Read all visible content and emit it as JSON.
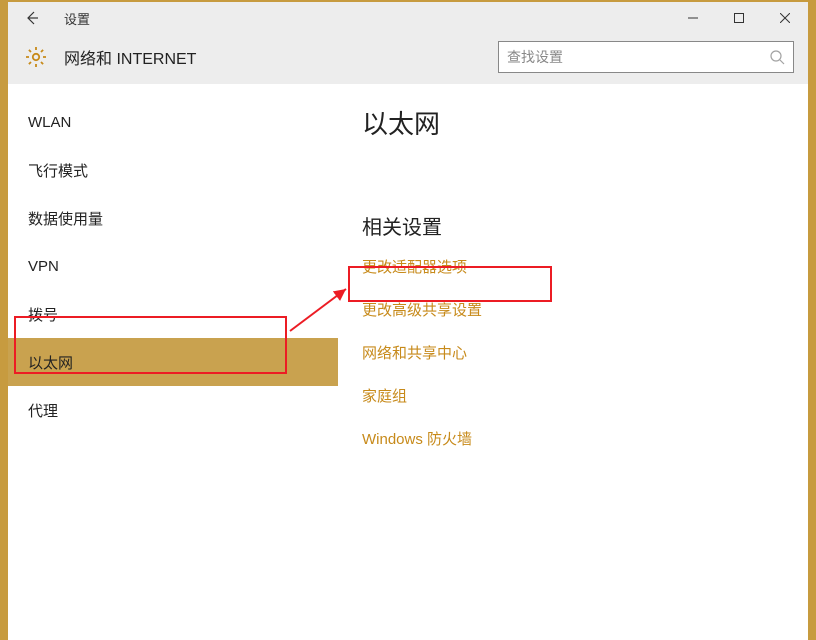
{
  "titlebar": {
    "title": "设置"
  },
  "header": {
    "label": "网络和 INTERNET"
  },
  "search": {
    "placeholder": "查找设置"
  },
  "sidebar": {
    "items": [
      {
        "label": "WLAN",
        "selected": false
      },
      {
        "label": "飞行模式",
        "selected": false
      },
      {
        "label": "数据使用量",
        "selected": false
      },
      {
        "label": "VPN",
        "selected": false
      },
      {
        "label": "拨号",
        "selected": false
      },
      {
        "label": "以太网",
        "selected": true
      },
      {
        "label": "代理",
        "selected": false
      }
    ]
  },
  "content": {
    "heading": "以太网",
    "related_heading": "相关设置",
    "links": [
      "更改适配器选项",
      "更改高级共享设置",
      "网络和共享中心",
      "家庭组",
      "Windows 防火墙"
    ]
  },
  "annotations": {
    "highlighted_sidebar_item": "以太网",
    "highlighted_link": "更改适配器选项"
  }
}
